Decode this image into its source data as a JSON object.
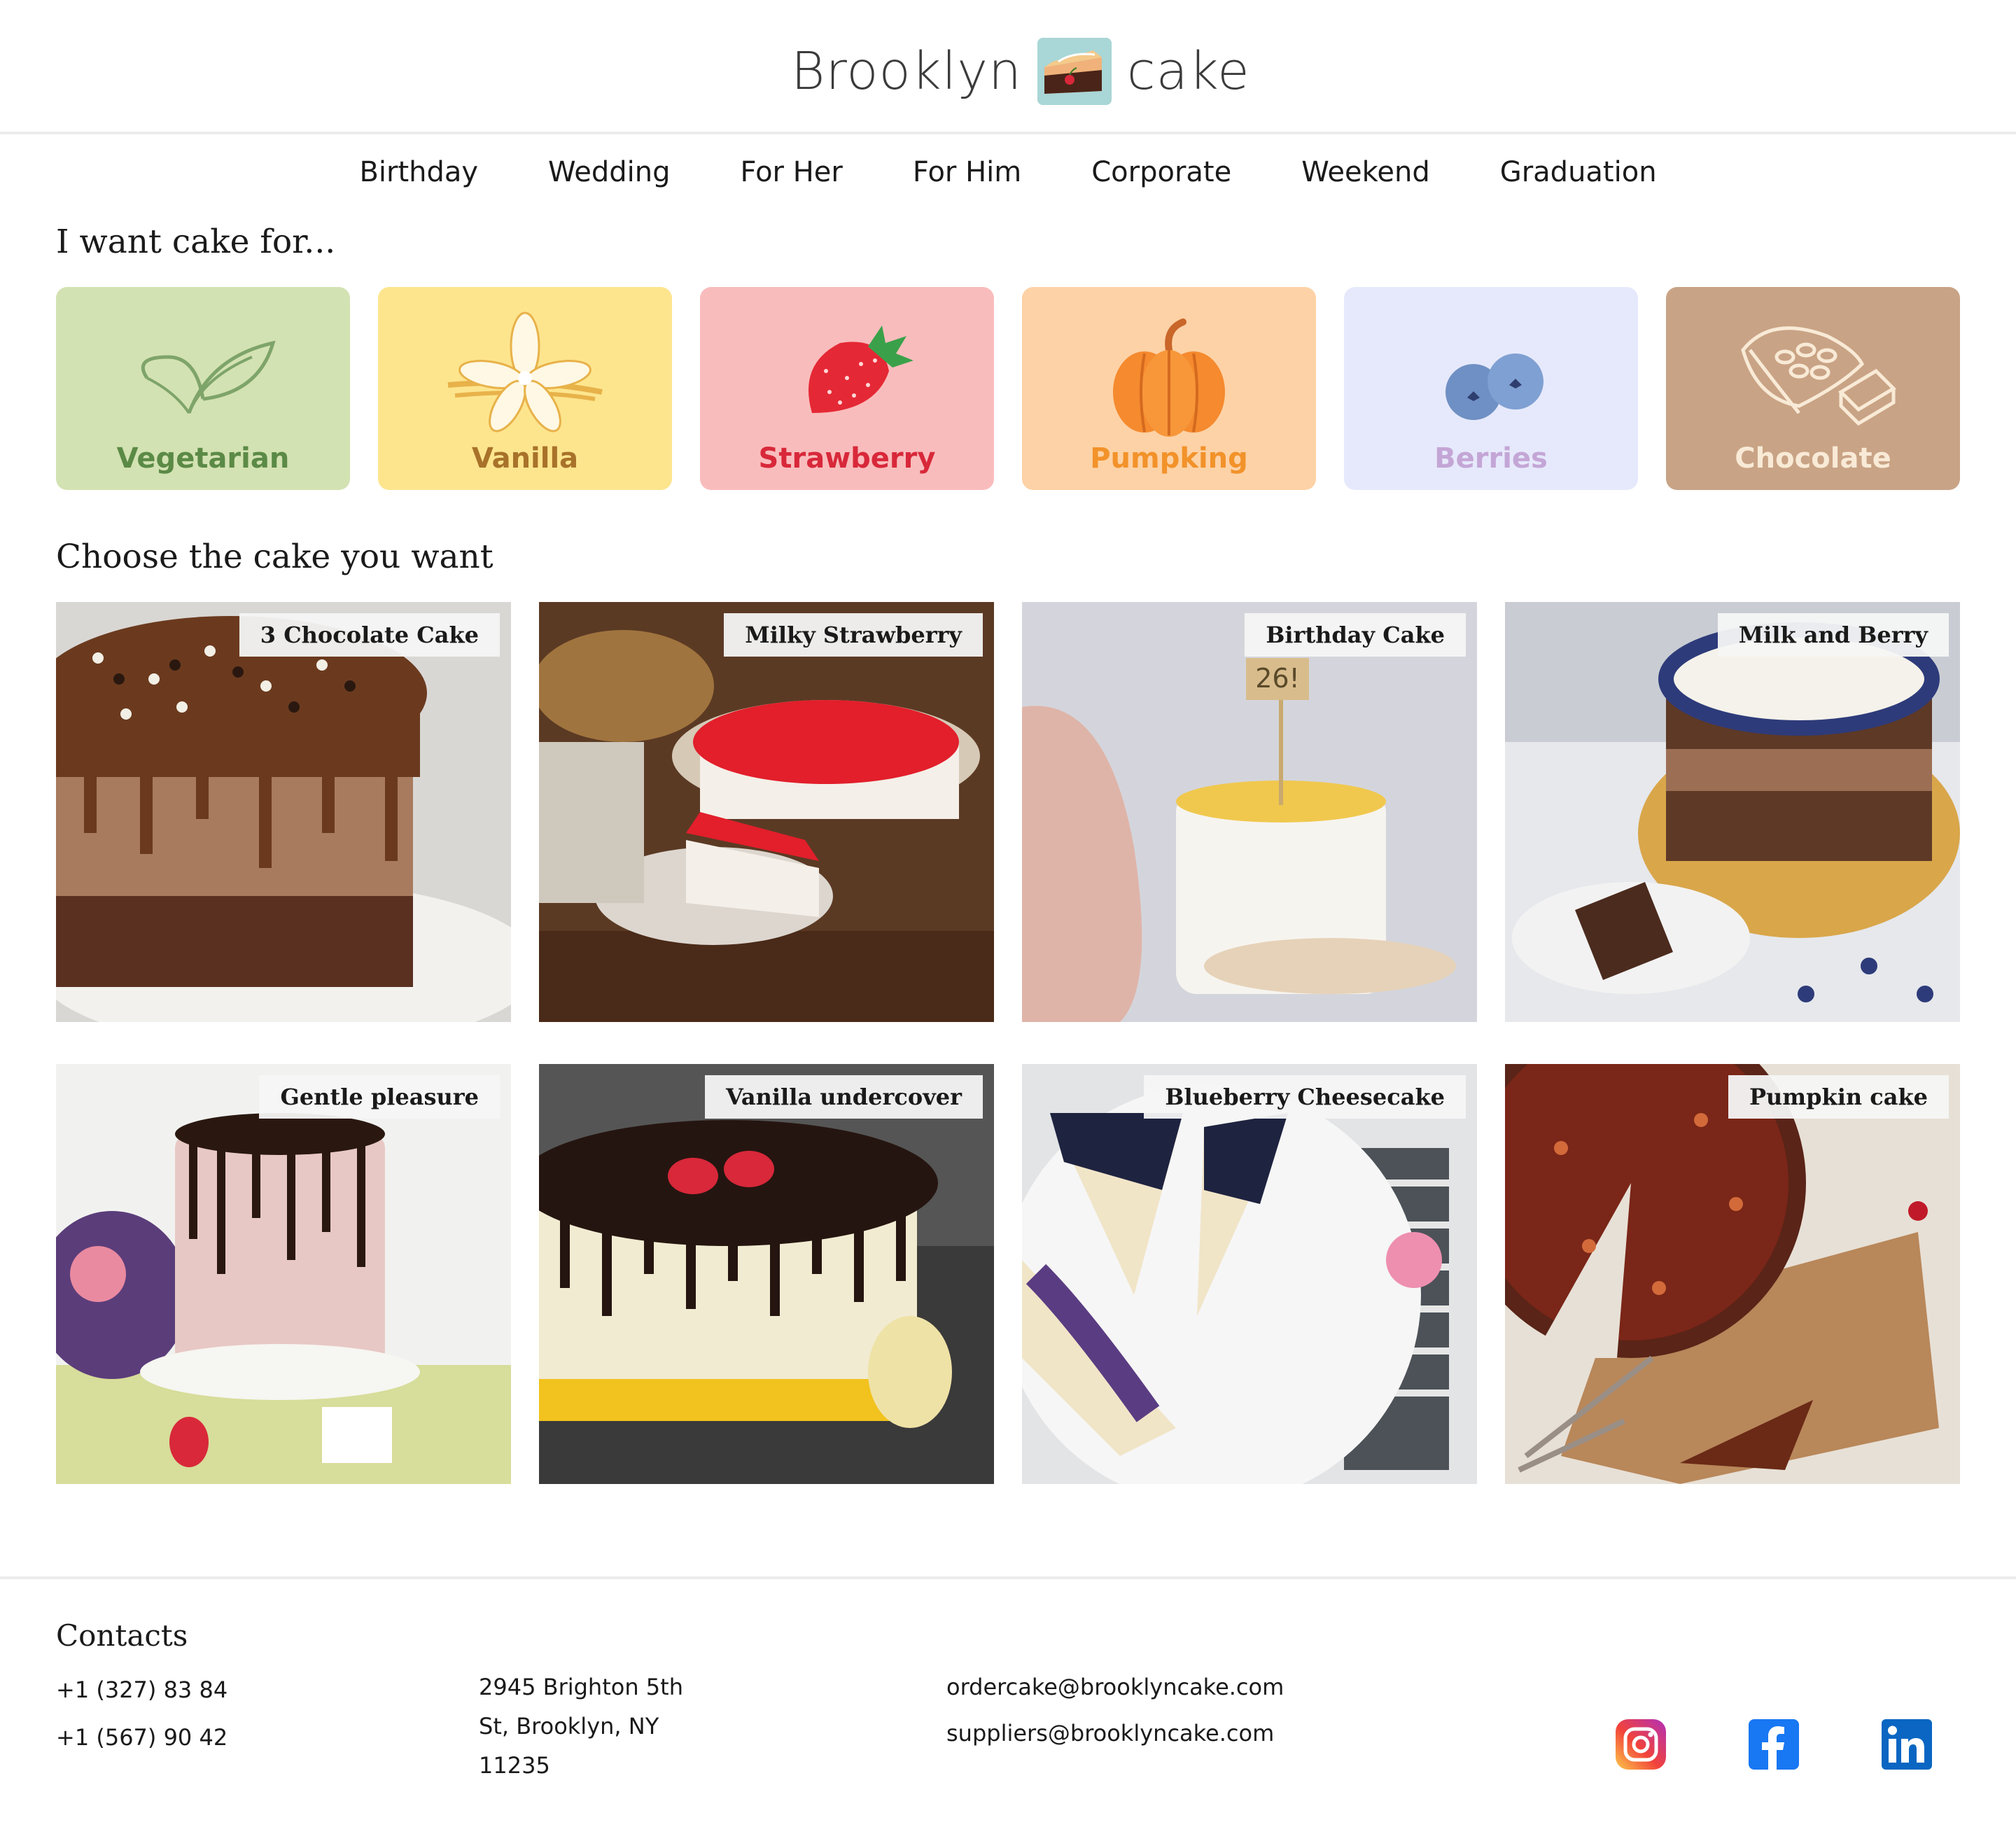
{
  "brand": {
    "word_left": "Brooklyn",
    "word_right": "cake",
    "logo_icon": "cake-slice-icon"
  },
  "nav": [
    "Birthday",
    "Wedding",
    "For Her",
    "For Him",
    "Corporate",
    "Weekend",
    "Graduation"
  ],
  "sections": {
    "categories_title": "I want cake for...",
    "cakes_title": "Choose the cake you want"
  },
  "categories": [
    {
      "label": "Vegetarian",
      "icon": "leaf-icon",
      "bg": "#d3e2b2",
      "color": "#5b8a46"
    },
    {
      "label": "Vanilla",
      "icon": "vanilla-flower-icon",
      "bg": "#fde58e",
      "color": "#a8722a"
    },
    {
      "label": "Strawberry",
      "icon": "strawberry-icon",
      "bg": "#f9bcbc",
      "color": "#d8283a"
    },
    {
      "label": "Pumpking",
      "icon": "pumpkin-icon",
      "bg": "#fdd2a6",
      "color": "#f2922a"
    },
    {
      "label": "Berries",
      "icon": "blueberries-icon",
      "bg": "#e6e9fb",
      "color": "#c4a6d6"
    },
    {
      "label": "Chocolate",
      "icon": "cocoa-icon",
      "bg": "#c9a385",
      "color": "#f8ead6"
    }
  ],
  "cakes": [
    {
      "name": "3 Chocolate Cake"
    },
    {
      "name": "Milky Strawberry"
    },
    {
      "name": "Birthday Cake"
    },
    {
      "name": "Milk and Berry"
    },
    {
      "name": "Gentle pleasure"
    },
    {
      "name": "Vanilla undercover"
    },
    {
      "name": "Blueberry Cheesecake"
    },
    {
      "name": "Pumpkin cake"
    }
  ],
  "contacts": {
    "title": "Contacts",
    "phones": [
      "+1 (327) 83 84",
      "+1 (567) 90 42"
    ],
    "address": [
      "2945 Brighton 5th",
      "St, Brooklyn, NY",
      "11235"
    ],
    "emails": [
      "ordercake@brooklyncake.com",
      "suppliers@brooklyncake.com"
    ],
    "social": [
      "instagram-icon",
      "facebook-icon",
      "linkedin-icon"
    ]
  }
}
